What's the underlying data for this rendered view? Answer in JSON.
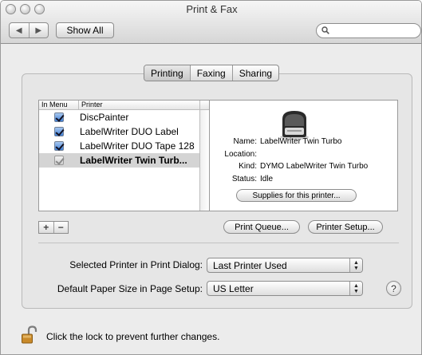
{
  "window": {
    "title": "Print & Fax",
    "nav_back": "◀",
    "nav_forward": "▶",
    "show_all_label": "Show All",
    "search_placeholder": ""
  },
  "tabs": [
    {
      "label": "Printing",
      "selected": true
    },
    {
      "label": "Faxing",
      "selected": false
    },
    {
      "label": "Sharing",
      "selected": false
    }
  ],
  "printer_list": {
    "headers": {
      "in_menu": "In Menu",
      "printer": "Printer"
    },
    "rows": [
      {
        "name": "DiscPainter",
        "in_menu": true,
        "selected": false
      },
      {
        "name": "LabelWriter DUO Label",
        "in_menu": true,
        "selected": false
      },
      {
        "name": "LabelWriter DUO Tape 128",
        "in_menu": true,
        "selected": false
      },
      {
        "name": "LabelWriter Twin Turb...",
        "in_menu": true,
        "selected": true
      }
    ]
  },
  "details": {
    "name_label": "Name:",
    "name_value": "LabelWriter Twin Turbo",
    "location_label": "Location:",
    "location_value": "",
    "kind_label": "Kind:",
    "kind_value": "DYMO LabelWriter Twin Turbo",
    "status_label": "Status:",
    "status_value": "Idle",
    "supplies_button": "Supplies for this printer..."
  },
  "buttons": {
    "add": "+",
    "remove": "−",
    "print_queue": "Print Queue...",
    "printer_setup": "Printer Setup..."
  },
  "settings": {
    "selected_printer_label": "Selected Printer in Print Dialog:",
    "selected_printer_value": "Last Printer Used",
    "paper_size_label": "Default Paper Size in Page Setup:",
    "paper_size_value": "US Letter",
    "help": "?"
  },
  "footer": {
    "lock_text": "Click the lock to prevent further changes."
  },
  "colors": {
    "checkbox_blue": "#3f7fd6",
    "selection_gray": "#d4d4d4",
    "lock_gold": "#c98a2a"
  }
}
